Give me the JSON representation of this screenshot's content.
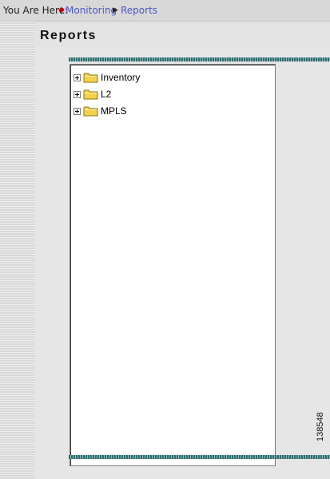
{
  "breadcrumb": {
    "prefix": "You Are Here:",
    "items": [
      "Monitoring",
      "Reports"
    ]
  },
  "page": {
    "title": "Reports"
  },
  "tree": {
    "items": [
      {
        "label": "Inventory",
        "expander": "plus",
        "icon": "folder-icon"
      },
      {
        "label": "L2",
        "expander": "plus",
        "icon": "folder-icon"
      },
      {
        "label": "MPLS",
        "expander": "plus",
        "icon": "folder-icon"
      }
    ]
  },
  "figure_id": "138548",
  "colors": {
    "link": "#4a57c8",
    "bullet": "#cc0000",
    "panel_border": "#2f6e6e",
    "folder": "#f2d24a"
  }
}
